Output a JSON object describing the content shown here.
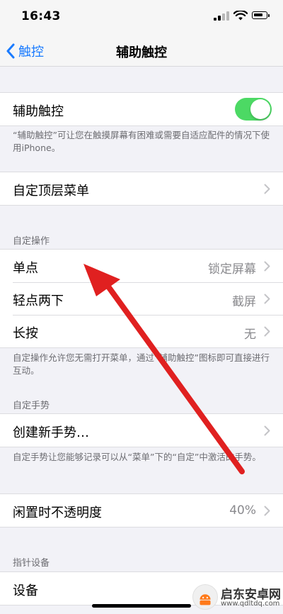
{
  "status_bar": {
    "time": "16:43"
  },
  "nav": {
    "back_label": "触控",
    "title": "辅助触控"
  },
  "assistive_touch": {
    "label": "辅助触控",
    "enabled": true,
    "toggle_color": "#4cd964",
    "footer": "“辅助触控”可让您在触摸屏幕有困难或需要自适应配件的情况下使用iPhone。"
  },
  "top_menu": {
    "label": "自定顶层菜单"
  },
  "custom_actions": {
    "header": "自定操作",
    "items": [
      {
        "label": "单点",
        "value": "锁定屏幕"
      },
      {
        "label": "轻点两下",
        "value": "截屏"
      },
      {
        "label": "长按",
        "value": "无"
      }
    ],
    "footer": "自定操作允许您无需打开菜单，通过“辅助触控”图标即可直接进行互动。"
  },
  "custom_gestures": {
    "header": "自定手势",
    "create_label": "创建新手势…",
    "footer": "自定手势让您能够记录可以从“菜单”下的“自定”中激活的手势。"
  },
  "idle_opacity": {
    "label": "闲置时不透明度",
    "value": "40%"
  },
  "pointer_devices": {
    "header": "指针设备",
    "devices_label": "设备"
  },
  "watermark": {
    "title": "启东安卓网",
    "url": "www.qdltdq.com"
  },
  "colors": {
    "accent": "#1a7bff",
    "annotation_arrow": "#e02020"
  }
}
